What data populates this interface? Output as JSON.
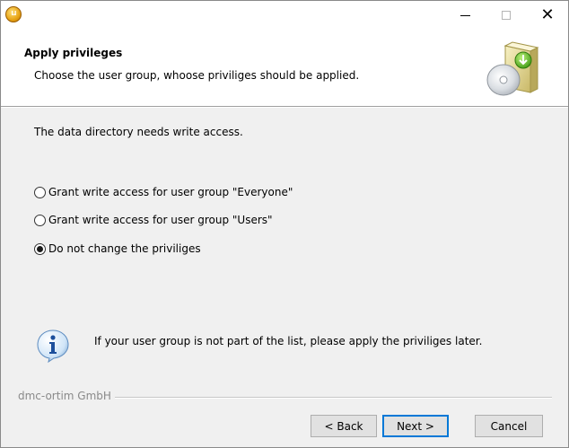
{
  "titlebar": {
    "icon": "installer-icon",
    "controls": {
      "minimize": "minimize-icon",
      "maximize": "maximize-icon",
      "close": "close-icon"
    }
  },
  "header": {
    "title": "Apply privileges",
    "subtitle": "Choose the user group, whoose priviliges should be applied.",
    "image": "installer-disc-icon"
  },
  "content": {
    "info": "The data directory needs write access.",
    "options": [
      {
        "label": "Grant write access for user group \"Everyone\"",
        "checked": false
      },
      {
        "label": "Grant write access for user group \"Users\"",
        "checked": false
      },
      {
        "label": "Do not change the priviliges",
        "checked": true
      }
    ],
    "note": "If your user group is not part of the list, please apply the priviliges later.",
    "note_icon": "info-icon"
  },
  "footer": {
    "brand": "dmc-ortim GmbH",
    "back_label": "< Back",
    "next_label": "Next >",
    "cancel_label": "Cancel"
  },
  "colors": {
    "default_button_border": "#0078d7",
    "window_background": "#f0f0f0",
    "header_background": "#ffffff"
  }
}
